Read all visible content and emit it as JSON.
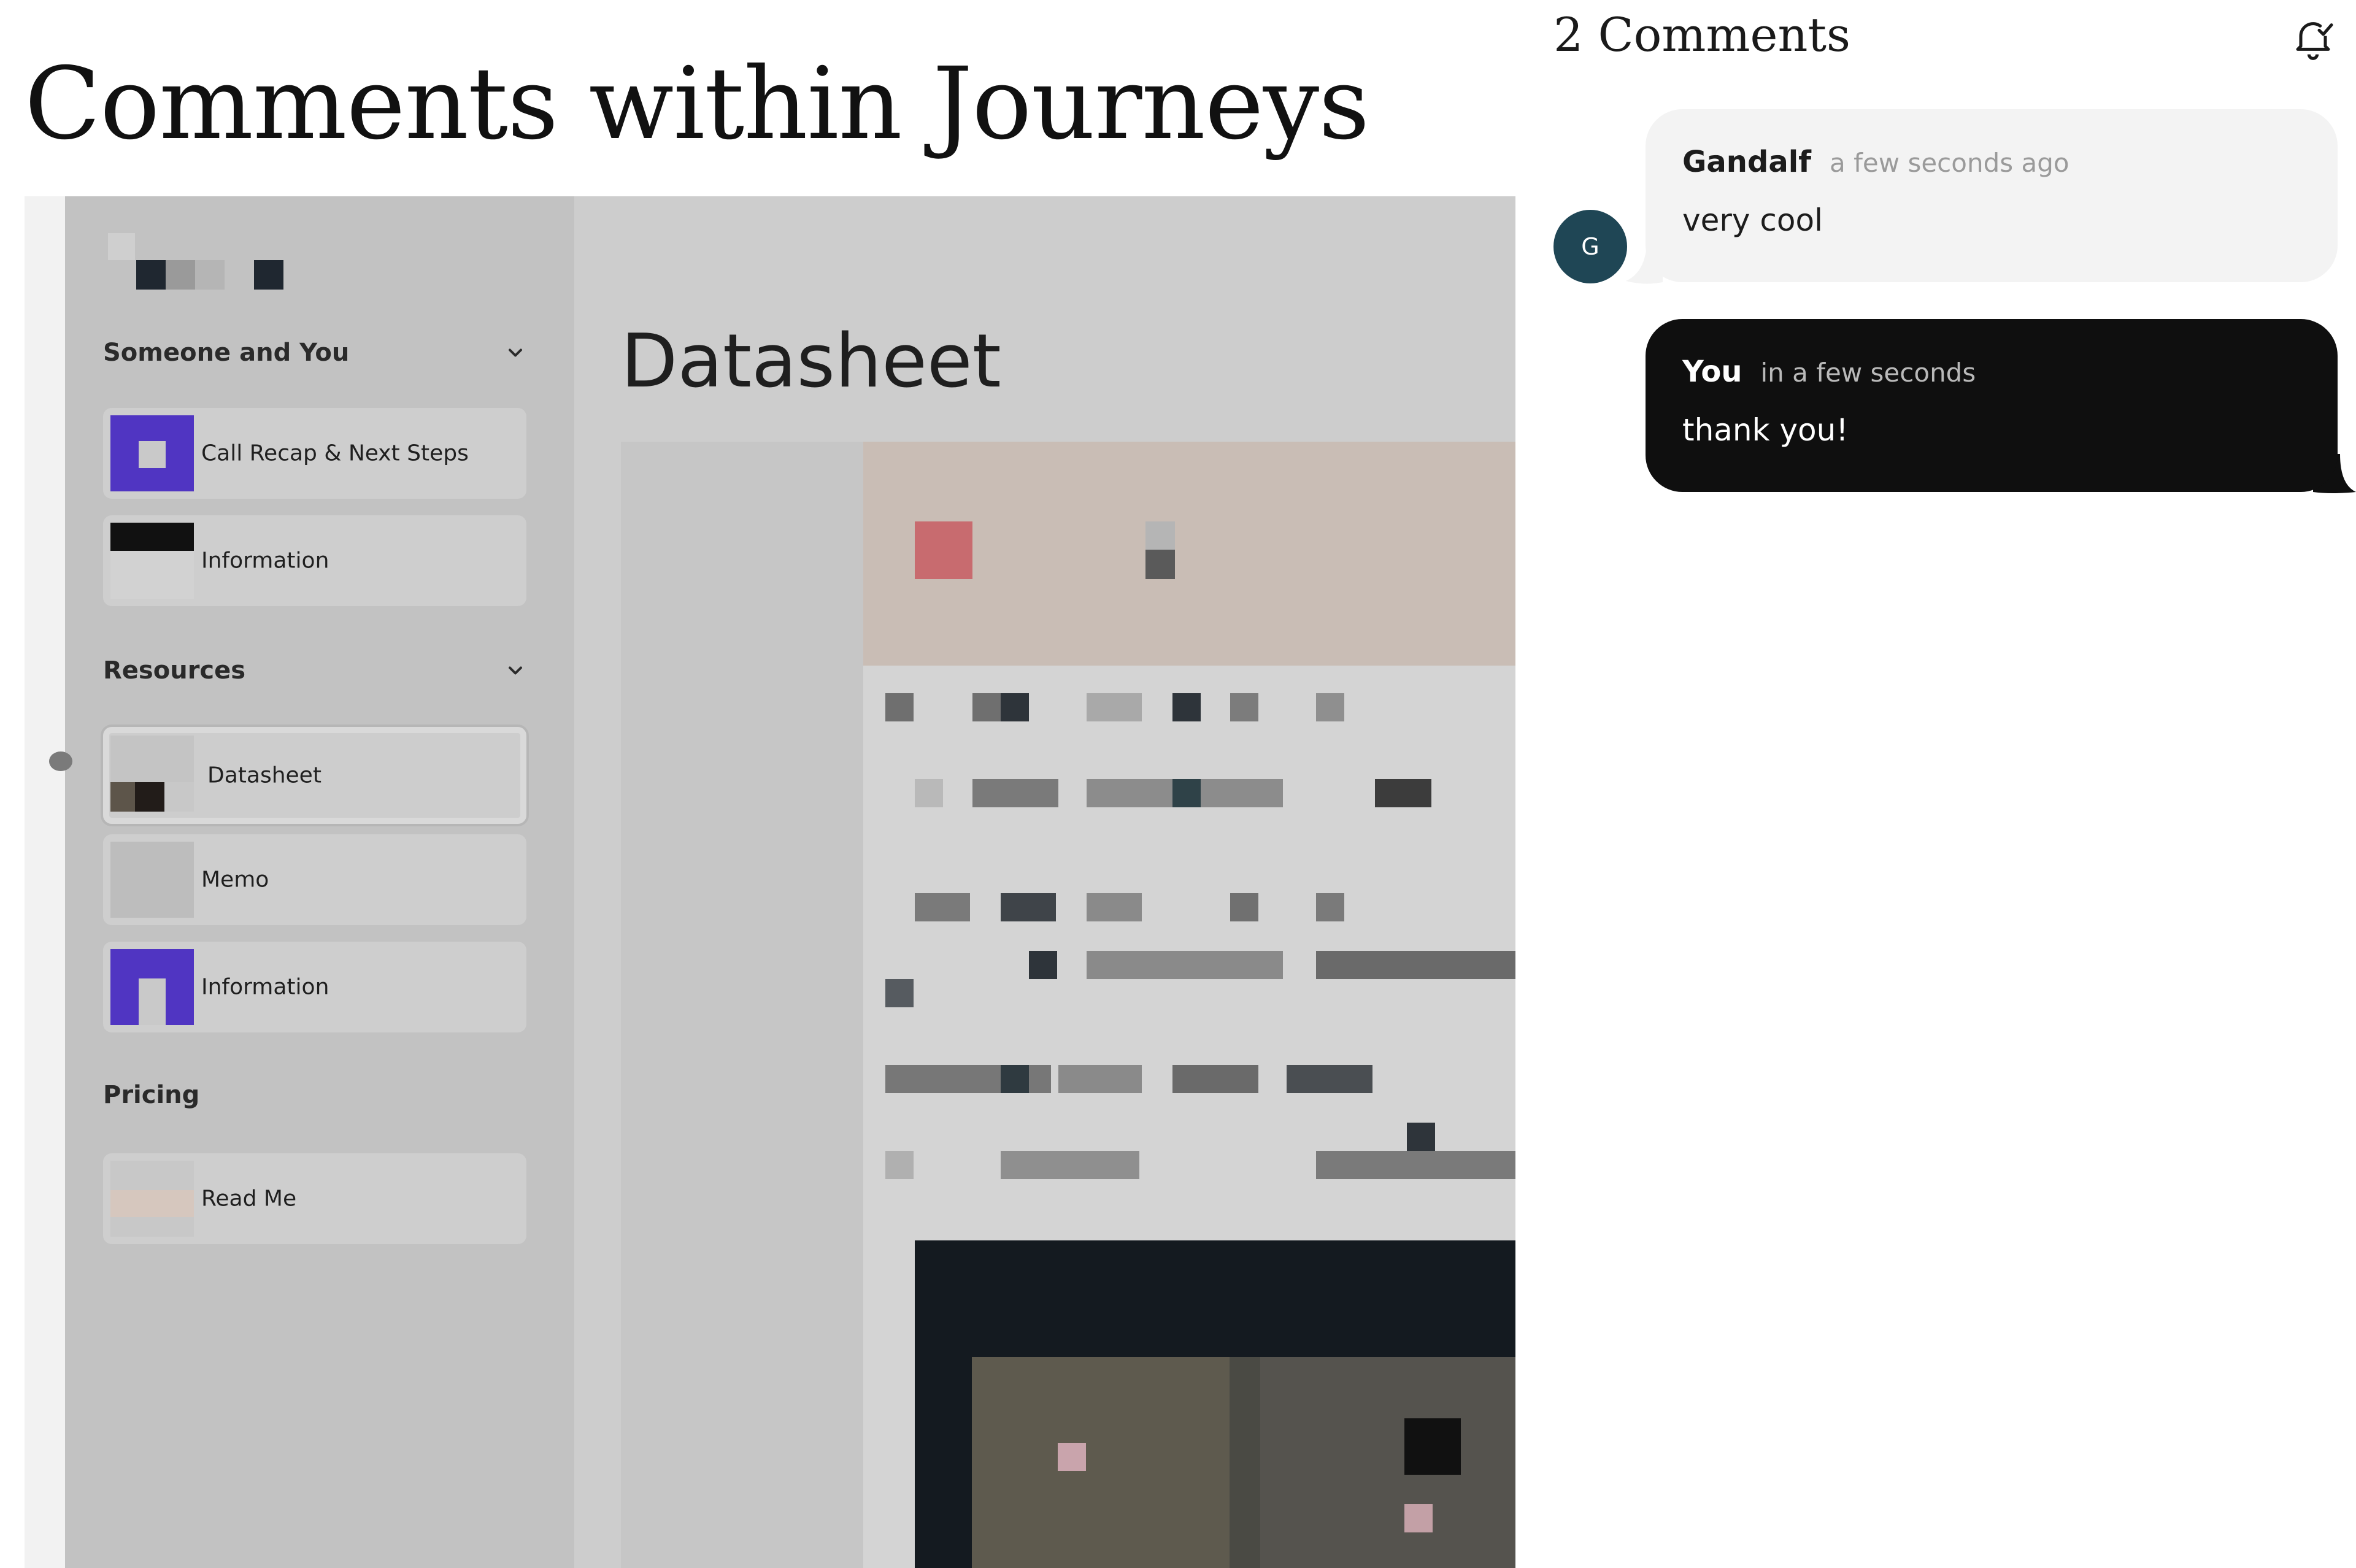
{
  "page": {
    "title": "Comments within Journeys"
  },
  "preview": {
    "sidebar": {
      "sections": [
        {
          "title": "Someone and You",
          "items": [
            "Call Recap & Next Steps",
            "Information"
          ]
        },
        {
          "title": "Resources",
          "items": [
            "Datasheet",
            "Memo",
            "Information"
          ]
        },
        {
          "title": "Pricing",
          "items": [
            "Read Me"
          ]
        }
      ],
      "active_item": "Datasheet"
    },
    "document": {
      "title": "Datasheet"
    }
  },
  "comments": {
    "header": "2 Comments",
    "icons": {
      "bell": "bell-icon",
      "chevron": "chevron-down-icon"
    },
    "list": [
      {
        "author": "Gandalf",
        "time": "a few seconds ago",
        "text": "very cool",
        "avatar_initial": "G",
        "avatar_color": "#1f4655"
      },
      {
        "author": "You",
        "time": "in a few seconds",
        "text": "thank you!"
      }
    ]
  }
}
